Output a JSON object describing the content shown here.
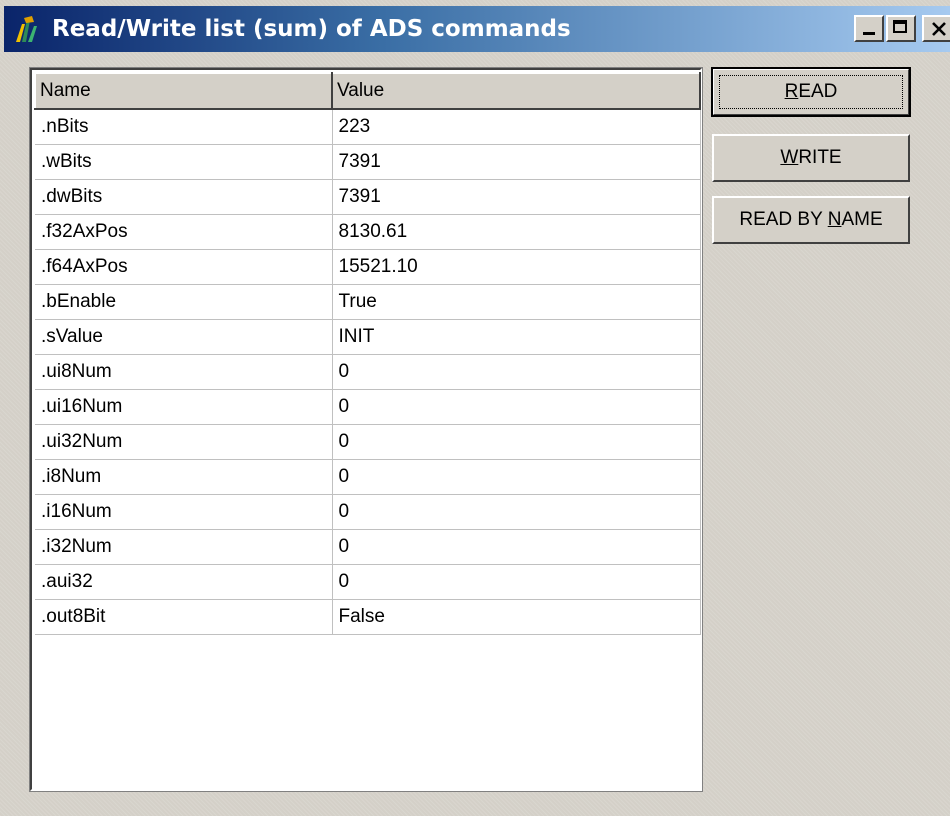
{
  "window": {
    "title": "Read/Write list (sum) of ADS commands",
    "icon": "twincat-ads-icon"
  },
  "list": {
    "columns": [
      "Name",
      "Value"
    ],
    "rows": [
      {
        "name": ".nBits",
        "value": "223"
      },
      {
        "name": ".wBits",
        "value": "7391"
      },
      {
        "name": ".dwBits",
        "value": "7391"
      },
      {
        "name": ".f32AxPos",
        "value": "8130.61"
      },
      {
        "name": ".f64AxPos",
        "value": "15521.10"
      },
      {
        "name": ".bEnable",
        "value": "True"
      },
      {
        "name": ".sValue",
        "value": "INIT"
      },
      {
        "name": ".ui8Num",
        "value": "0"
      },
      {
        "name": ".ui16Num",
        "value": "0"
      },
      {
        "name": ".ui32Num",
        "value": "0"
      },
      {
        "name": ".i8Num",
        "value": "0"
      },
      {
        "name": ".i16Num",
        "value": "0"
      },
      {
        "name": ".i32Num",
        "value": "0"
      },
      {
        "name": ".aui32",
        "value": "0"
      },
      {
        "name": ".out8Bit",
        "value": "False"
      }
    ]
  },
  "buttons": {
    "read": {
      "pre": "",
      "accel": "R",
      "post": "EAD"
    },
    "write": {
      "pre": "",
      "accel": "W",
      "post": "RITE"
    },
    "read_by_name": {
      "pre": "READ BY ",
      "accel": "N",
      "post": "AME"
    }
  },
  "colors": {
    "titlebar_start": "#0a246a",
    "titlebar_end": "#a6caf0",
    "face": "#d4d0c8"
  }
}
